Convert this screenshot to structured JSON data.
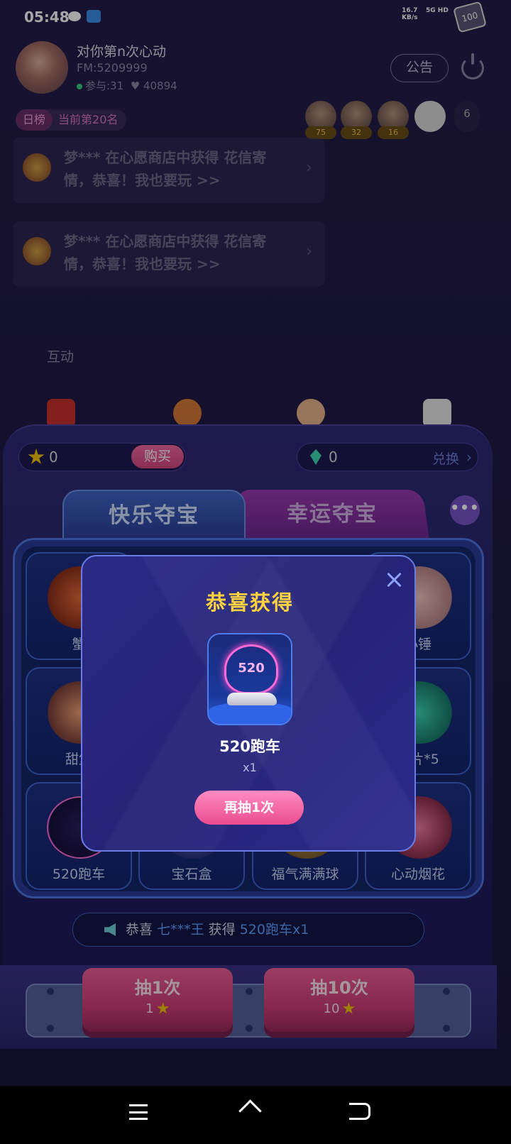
{
  "status_bar": {
    "time": "05:48",
    "net_speed": "16.7",
    "net_unit": "KB/s",
    "signal": "5G HD",
    "battery": "100",
    "icons": [
      "wechat-icon",
      "app-notification-icon"
    ]
  },
  "room": {
    "title": "对你第n次心动",
    "fm": "FM:5209999",
    "participants": "参与:31",
    "likes": "40894",
    "notice_label": "公告",
    "rank_tag": "日榜",
    "rank_text": "当前第20名",
    "viewers": [
      {
        "count": "75"
      },
      {
        "count": "32"
      },
      {
        "count": "16"
      },
      {
        "count": ""
      }
    ],
    "viewer_total": "6",
    "messages": [
      {
        "text": "梦*** 在心愿商店中获得 花信寄情，恭喜！我也要玩 >>"
      },
      {
        "text": "梦*** 在心愿商店中获得 花信寄情，恭喜！我也要玩 >>"
      }
    ],
    "interact_label": "互动"
  },
  "panel": {
    "stars": "0",
    "buy_label": "购买",
    "gems": "0",
    "exchange_label": "兑换",
    "tabs": [
      {
        "label": "快乐夺宝",
        "active": true
      },
      {
        "label": "幸运夺宝",
        "active": false
      }
    ],
    "more_label": "•••",
    "grid": [
      {
        "label": "蟹"
      },
      {
        "label": "小锤"
      },
      {
        "label": "甜堡"
      },
      {
        "label": "碎片*5"
      },
      {
        "label": "520跑车"
      },
      {
        "label": "宝石盒"
      },
      {
        "label": "福气满满球"
      },
      {
        "label": "心动烟花"
      }
    ],
    "broadcast": {
      "prefix": "恭喜",
      "user": "七***王",
      "middle": "获得",
      "item": "520跑车x1"
    },
    "draw_once": {
      "label": "抽1次",
      "cost": "1"
    },
    "draw_ten": {
      "label": "抽10次",
      "cost": "10"
    }
  },
  "modal": {
    "title": "恭喜获得",
    "prize_badge": "520",
    "prize_name": "520跑车",
    "prize_qty": "x1",
    "again_label": "再抽1次"
  }
}
